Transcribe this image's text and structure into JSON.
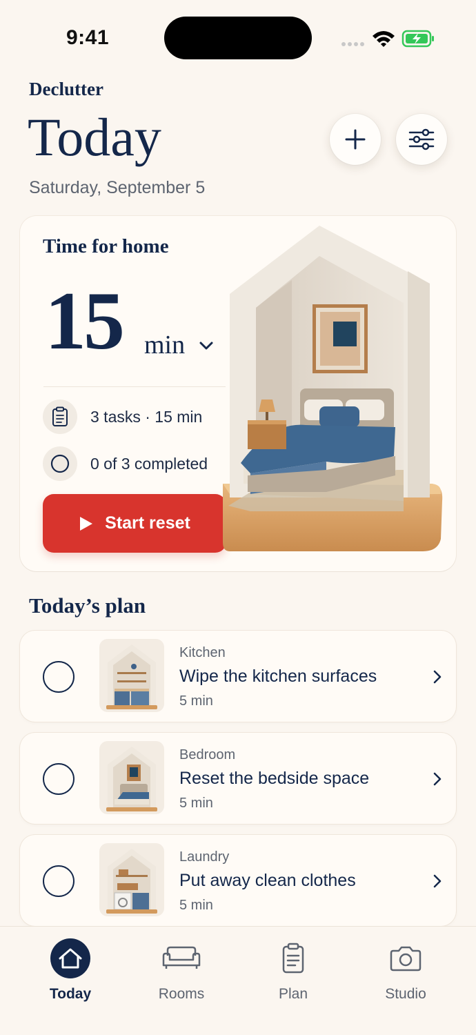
{
  "status_bar": {
    "time": "9:41"
  },
  "header": {
    "brand": "Declutter",
    "title": "Today",
    "date": "Saturday, September 5",
    "add_icon": "plus-icon",
    "filter_icon": "sliders-icon"
  },
  "hero": {
    "title": "Time for home",
    "minutes": "15",
    "unit": "min",
    "stats": [
      {
        "icon": "clipboard-icon",
        "text": "3 tasks · 15 min"
      },
      {
        "icon": "circle-icon",
        "text": "0 of 3 completed"
      }
    ],
    "start_label": "Start reset",
    "accent": "#d8342d"
  },
  "plan": {
    "title": "Today’s plan",
    "tasks": [
      {
        "category": "Kitchen",
        "name": "Wipe the kitchen surfaces",
        "duration": "5 min",
        "completed": false
      },
      {
        "category": "Bedroom",
        "name": "Reset the bedside space",
        "duration": "5 min",
        "completed": false
      },
      {
        "category": "Laundry",
        "name": "Put away clean clothes",
        "duration": "5 min",
        "completed": false
      }
    ]
  },
  "tabbar": {
    "active": "Today",
    "tabs": [
      {
        "label": "Today",
        "icon": "home-icon"
      },
      {
        "label": "Rooms",
        "icon": "sofa-icon"
      },
      {
        "label": "Plan",
        "icon": "clipboard-icon"
      },
      {
        "label": "Studio",
        "icon": "camera-icon"
      }
    ]
  },
  "colors": {
    "navy": "#14274a",
    "background": "#fbf6f0"
  }
}
